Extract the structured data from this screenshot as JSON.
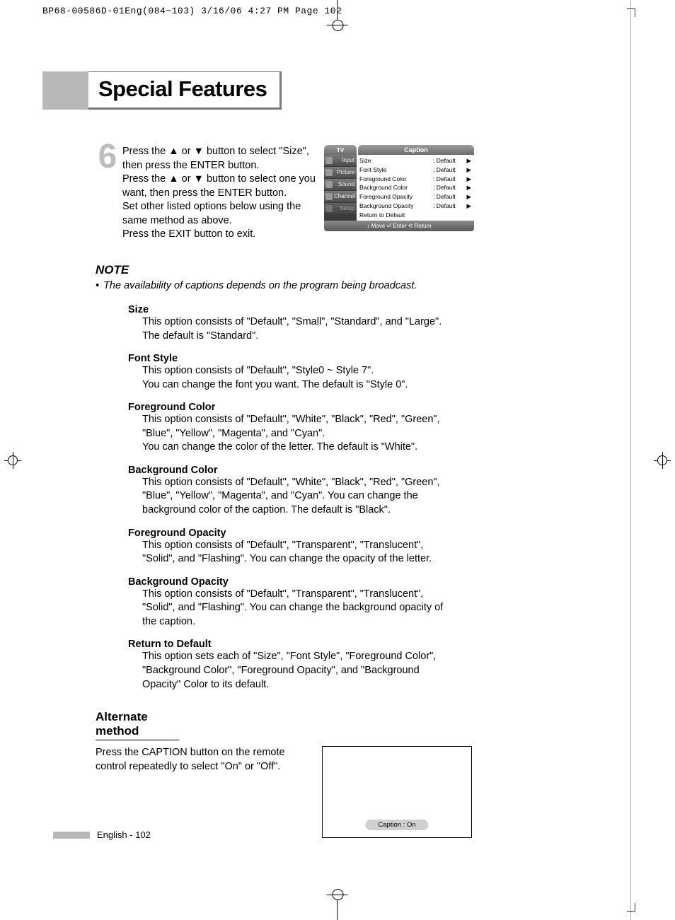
{
  "header_line": "BP68-00586D-01Eng(084~103)  3/16/06  4:27 PM  Page 102",
  "title": "Special Features",
  "step": {
    "num": "6",
    "text": "Press the ▲ or ▼ button to select \"Size\", then press the ENTER button.\nPress the ▲ or ▼ button to select one you want, then press the ENTER button.\nSet other listed options below using the same method as above.\nPress the EXIT button to exit."
  },
  "osd": {
    "tv": "TV",
    "title": "Caption",
    "side": [
      "Input",
      "Picture",
      "Sound",
      "Channel",
      "Setup"
    ],
    "rows": [
      {
        "label": "Size",
        "val": ": Default",
        "arr": "▶"
      },
      {
        "label": "Font Style",
        "val": ": Default",
        "arr": "▶"
      },
      {
        "label": "Foreground Color",
        "val": ": Default",
        "arr": "▶"
      },
      {
        "label": "Background Color",
        "val": ": Default",
        "arr": "▶"
      },
      {
        "label": "Foreground Opacity",
        "val": ": Default",
        "arr": "▶"
      },
      {
        "label": "Background Opacity",
        "val": ": Default",
        "arr": "▶"
      },
      {
        "label": "Return to Default",
        "val": "",
        "arr": ""
      }
    ],
    "foot": "Move        Enter        Return",
    "foot_full": "↕ Move   ⏎ Enter   ⟲ Return"
  },
  "note": {
    "heading": "NOTE",
    "bullet": "•",
    "text": "The availability of captions depends on the program being broadcast."
  },
  "options": [
    {
      "title": "Size",
      "desc": "This option consists of \"Default\", \"Small\", \"Standard\", and \"Large\". The default is \"Standard\"."
    },
    {
      "title": "Font Style",
      "desc": "This option consists of \"Default\", \"Style0 ~ Style 7\".\nYou can change the font you want. The default is \"Style 0\"."
    },
    {
      "title": "Foreground Color",
      "desc": "This option consists of \"Default\", \"White\", \"Black\", \"Red\", \"Green\", \"Blue\", \"Yellow\", \"Magenta\", and \"Cyan\".\nYou can change the color of the letter. The default is \"White\"."
    },
    {
      "title": "Background Color",
      "desc": "This option consists of \"Default\", \"White\", \"Black\", \"Red\", \"Green\", \"Blue\", \"Yellow\", \"Magenta\", and \"Cyan\". You can change the background color of the caption. The default is \"Black\"."
    },
    {
      "title": "Foreground Opacity",
      "desc": "This option consists of \"Default\", \"Transparent\", \"Translucent\", \"Solid\", and \"Flashing\". You can change the opacity of the letter."
    },
    {
      "title": "Background Opacity",
      "desc": "This option consists of \"Default\", \"Transparent\", \"Translucent\", \"Solid\", and \"Flashing\". You can change the background opacity of the caption."
    },
    {
      "title": "Return to Default",
      "desc": "This option sets each of \"Size\", \"Font Style\", \"Foreground Color\", \"Background Color\", \"Foreground Opacity\", and \"Background Opacity\" Color to its default."
    }
  ],
  "alt": {
    "heading": "Alternate method",
    "text": "Press the CAPTION button on the remote control repeatedly to select \"On\" or \"Off\".",
    "pill": "Caption : On"
  },
  "footer": "English - 102"
}
